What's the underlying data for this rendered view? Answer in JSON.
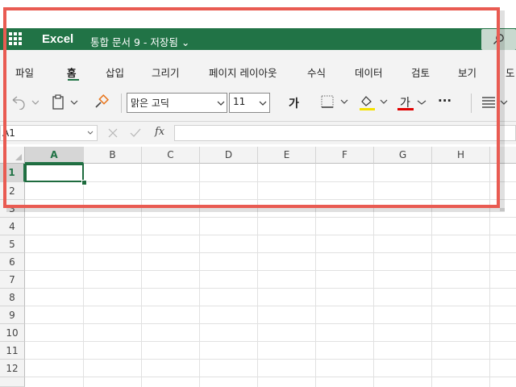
{
  "title_bar": {
    "app_name": "Excel",
    "doc_title": "통합 문서 9  -  저장됨 ⌄",
    "background": "#217346"
  },
  "tabs": [
    {
      "label": "파일"
    },
    {
      "label": "홈",
      "active": true
    },
    {
      "label": "삽입"
    },
    {
      "label": "그리기"
    },
    {
      "label": "페이지 레이아웃"
    },
    {
      "label": "수식"
    },
    {
      "label": "데이터"
    },
    {
      "label": "검토"
    },
    {
      "label": "보기"
    },
    {
      "label": "도"
    }
  ],
  "toolbar": {
    "font_name": "맑은 고딕",
    "font_size": "11",
    "bold_glyph": "가",
    "font_color_glyph": "가",
    "more_glyph": "···",
    "fill_color": "#f5e100",
    "font_color": "#e00000",
    "icons": [
      "undo-icon",
      "paste-icon",
      "format-painter-icon",
      "borders-icon",
      "fill-color-icon",
      "font-color-icon",
      "more-icon",
      "align-icon"
    ]
  },
  "formula_bar": {
    "name_box": "A1",
    "fx": "fx",
    "formula_value": ""
  },
  "grid": {
    "columns": [
      "A",
      "B",
      "C",
      "D",
      "E",
      "F",
      "G",
      "H"
    ],
    "rows": [
      "1",
      "2",
      "3",
      "4",
      "5",
      "6",
      "7",
      "8",
      "9",
      "10",
      "11",
      "12"
    ],
    "selected_cell": "A1"
  },
  "highlight_color": "#e95b52"
}
